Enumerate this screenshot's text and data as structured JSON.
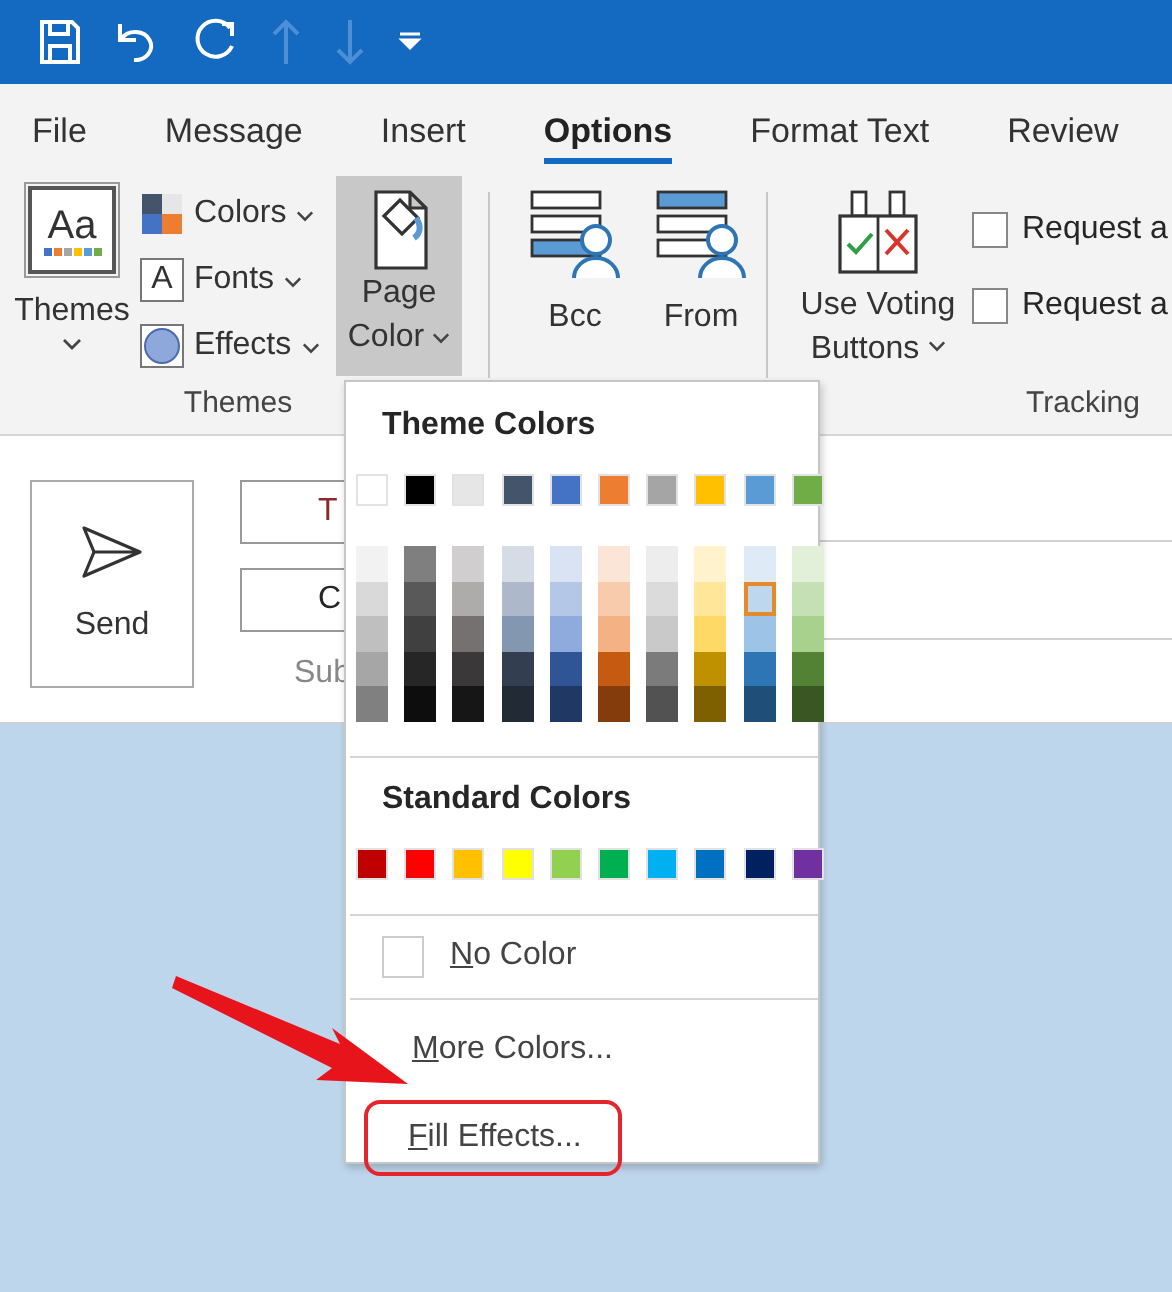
{
  "quick_access": [
    {
      "kind": "save",
      "disabled": false
    },
    {
      "kind": "undo",
      "disabled": false
    },
    {
      "kind": "redo",
      "disabled": false
    },
    {
      "kind": "up",
      "disabled": true
    },
    {
      "kind": "down",
      "disabled": true
    },
    {
      "kind": "customize",
      "disabled": false
    }
  ],
  "tabs": [
    {
      "label": "File",
      "selected": false
    },
    {
      "label": "Message",
      "selected": false
    },
    {
      "label": "Insert",
      "selected": false
    },
    {
      "label": "Options",
      "selected": true
    },
    {
      "label": "Format Text",
      "selected": false
    },
    {
      "label": "Review",
      "selected": false
    }
  ],
  "themes_group": {
    "themes_button": {
      "icon_text": "Aa",
      "label": "Themes"
    },
    "small_buttons": [
      {
        "kind": "colors",
        "label": "Colors"
      },
      {
        "kind": "fonts",
        "label": "Fonts",
        "icon_text": "A"
      },
      {
        "kind": "effects",
        "label": "Effects"
      }
    ],
    "page_color_button": {
      "label_lines": [
        "Page",
        "Color"
      ],
      "expanded": true
    },
    "label": "Themes"
  },
  "address_group": {
    "buttons": [
      {
        "kind": "bcc",
        "label": "Bcc"
      },
      {
        "kind": "from",
        "label": "From"
      }
    ]
  },
  "tracking_group": {
    "voting_button": {
      "label_lines": [
        "Use Voting",
        "Buttons"
      ]
    },
    "checkboxes": [
      {
        "label": "Request a",
        "checked": false
      },
      {
        "label": "Request a",
        "checked": false
      }
    ],
    "label": "Tracking"
  },
  "compose": {
    "send_button": "Send",
    "to_button": "T",
    "cc_button": "C",
    "subject_label": "Sub"
  },
  "page_color_menu": {
    "theme_heading": "Theme Colors",
    "theme_colors": [
      {
        "color": "#ffffff",
        "selected": false
      },
      {
        "color": "#000000",
        "selected": false
      },
      {
        "color": "#e7e6e6",
        "selected": false
      },
      {
        "color": "#44546a",
        "selected": false
      },
      {
        "color": "#4472c4",
        "selected": false
      },
      {
        "color": "#ed7d31",
        "selected": false
      },
      {
        "color": "#a5a5a5",
        "selected": false
      },
      {
        "color": "#ffc000",
        "selected": false
      },
      {
        "color": "#5b9bd5",
        "selected": false
      },
      {
        "color": "#70ad47",
        "selected": false
      }
    ],
    "theme_shades": [
      [
        {
          "color": "#f2f2f2",
          "selected": false
        },
        {
          "color": "#7f7f7f",
          "selected": false
        },
        {
          "color": "#d0cece",
          "selected": false
        },
        {
          "color": "#d6dce5",
          "selected": false
        },
        {
          "color": "#dae3f3",
          "selected": false
        },
        {
          "color": "#fbe5d6",
          "selected": false
        },
        {
          "color": "#ededed",
          "selected": false
        },
        {
          "color": "#fff2cc",
          "selected": false
        },
        {
          "color": "#deebf7",
          "selected": false
        },
        {
          "color": "#e2f0d9",
          "selected": false
        }
      ],
      [
        {
          "color": "#d9d9d9",
          "selected": false
        },
        {
          "color": "#595959",
          "selected": false
        },
        {
          "color": "#aeabab",
          "selected": false
        },
        {
          "color": "#adb9ca",
          "selected": false
        },
        {
          "color": "#b4c7e7",
          "selected": false
        },
        {
          "color": "#f8cbad",
          "selected": false
        },
        {
          "color": "#dbdbdb",
          "selected": false
        },
        {
          "color": "#ffe699",
          "selected": false
        },
        {
          "color": "#bdd7ee",
          "selected": true
        },
        {
          "color": "#c5e0b4",
          "selected": false
        }
      ],
      [
        {
          "color": "#bfbfbf",
          "selected": false
        },
        {
          "color": "#404040",
          "selected": false
        },
        {
          "color": "#757171",
          "selected": false
        },
        {
          "color": "#8497b0",
          "selected": false
        },
        {
          "color": "#8faadc",
          "selected": false
        },
        {
          "color": "#f4b183",
          "selected": false
        },
        {
          "color": "#c9c9c9",
          "selected": false
        },
        {
          "color": "#ffd966",
          "selected": false
        },
        {
          "color": "#9dc3e6",
          "selected": false
        },
        {
          "color": "#a9d18e",
          "selected": false
        }
      ],
      [
        {
          "color": "#a6a6a6",
          "selected": false
        },
        {
          "color": "#262626",
          "selected": false
        },
        {
          "color": "#3a3838",
          "selected": false
        },
        {
          "color": "#333f50",
          "selected": false
        },
        {
          "color": "#2f5597",
          "selected": false
        },
        {
          "color": "#c55a11",
          "selected": false
        },
        {
          "color": "#7b7b7b",
          "selected": false
        },
        {
          "color": "#bf9000",
          "selected": false
        },
        {
          "color": "#2e75b6",
          "selected": false
        },
        {
          "color": "#548235",
          "selected": false
        }
      ],
      [
        {
          "color": "#808080",
          "selected": false
        },
        {
          "color": "#0d0d0d",
          "selected": false
        },
        {
          "color": "#171616",
          "selected": false
        },
        {
          "color": "#222a35",
          "selected": false
        },
        {
          "color": "#203864",
          "selected": false
        },
        {
          "color": "#843c0c",
          "selected": false
        },
        {
          "color": "#525252",
          "selected": false
        },
        {
          "color": "#7f6000",
          "selected": false
        },
        {
          "color": "#1f4e79",
          "selected": false
        },
        {
          "color": "#385723",
          "selected": false
        }
      ]
    ],
    "standard_heading": "Standard Colors",
    "standard_colors": [
      {
        "color": "#c00000",
        "selected": false
      },
      {
        "color": "#ff0000",
        "selected": false
      },
      {
        "color": "#ffc000",
        "selected": false
      },
      {
        "color": "#ffff00",
        "selected": false
      },
      {
        "color": "#92d050",
        "selected": false
      },
      {
        "color": "#00b050",
        "selected": false
      },
      {
        "color": "#00b0f0",
        "selected": false
      },
      {
        "color": "#0070c0",
        "selected": false
      },
      {
        "color": "#002060",
        "selected": false
      },
      {
        "color": "#7030a0",
        "selected": false
      }
    ],
    "no_color": {
      "access_key": "N",
      "rest": "o Color"
    },
    "items": [
      {
        "access_key": "M",
        "rest": "ore Colors...",
        "highlighted": false
      },
      {
        "access_key": "F",
        "rest": "ill Effects...",
        "highlighted": true
      }
    ]
  }
}
